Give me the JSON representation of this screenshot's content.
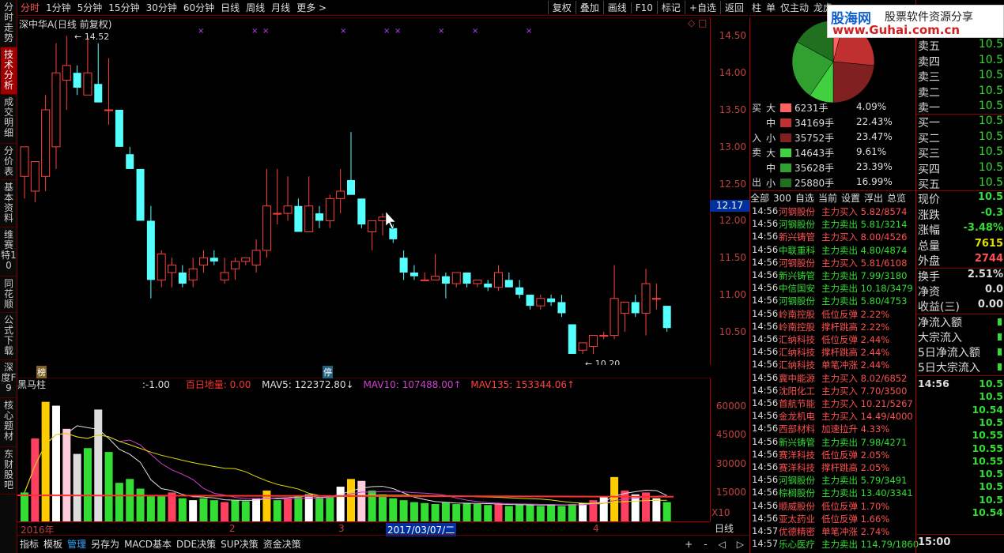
{
  "topbar": {
    "tabs": [
      "分时",
      "1分钟",
      "5分钟",
      "15分钟",
      "30分钟",
      "60分钟",
      "日线",
      "周线",
      "月线",
      "更多 >"
    ],
    "active": 0,
    "right": [
      "复权",
      "叠加",
      "画线",
      "F10",
      "标记",
      "+自选",
      "返回"
    ]
  },
  "leftbar": [
    "分时走势",
    "技术分析",
    "成交明细",
    "分价表",
    "基本资料",
    "维赛特10",
    "同花顺",
    "公式下载",
    "深度F9",
    "核心题材",
    "东财股吧"
  ],
  "chart": {
    "title": "深中华A(日线 前复权)",
    "high_label": "14.52",
    "low_label": "10.20",
    "cur_price": "12.17",
    "price_ticks": [
      "14.50",
      "14.00",
      "13.50",
      "13.00",
      "12.50",
      "12.00",
      "11.50",
      "11.00",
      "10.50"
    ],
    "marker1": "榜",
    "marker2": "停",
    "corner_icons": "◇ □"
  },
  "volume": {
    "title": "黑马柱",
    "v1": ":-1.00",
    "v2": "百日地量: 0.00",
    "mav5": "MAV5: 122372.80↓",
    "mav10": "MAV10: 107488.00↑",
    "mav135": "MAV135: 153344.06↑",
    "ticks": [
      "60000",
      "45000",
      "30000",
      "15000"
    ],
    "x10": "X10"
  },
  "dates": {
    "labels": [
      "2016年",
      "2",
      "3",
      "2017/03/07/二",
      "4"
    ],
    "period": "日线"
  },
  "bottombar": {
    "tabs": [
      "指标",
      "模板",
      "管理",
      "另存为",
      "MACD基本",
      "DDE决策",
      "SUP决策",
      "资金决策"
    ],
    "active": 2,
    "right": [
      "+",
      "-",
      "◁",
      "▷"
    ]
  },
  "midtabs": [
    "柱",
    "单",
    "仅主动",
    "龙虎"
  ],
  "flow": {
    "buy_label": [
      "买",
      "入"
    ],
    "sell_label": [
      "卖",
      "出"
    ],
    "rows": [
      {
        "size": "大",
        "vol": "6231手",
        "pct": "4.09%",
        "color": "#ff6060"
      },
      {
        "size": "中",
        "vol": "34169手",
        "pct": "22.43%",
        "color": "#c03030"
      },
      {
        "size": "小",
        "vol": "35752手",
        "pct": "23.47%",
        "color": "#802020"
      },
      {
        "size": "大",
        "vol": "14643手",
        "pct": "9.61%",
        "color": "#40d040"
      },
      {
        "size": "中",
        "vol": "35628手",
        "pct": "23.39%",
        "color": "#30a030"
      },
      {
        "size": "小",
        "vol": "25880手",
        "pct": "16.99%",
        "color": "#207020"
      }
    ]
  },
  "ticklist_tabs": [
    "全部",
    "300",
    "自选",
    "当前",
    "设置",
    "浮出",
    "总览"
  ],
  "ticks": [
    {
      "t": "14:56",
      "n": "河钢股份",
      "a": "主力买入 5.82/8574",
      "c": "#ff5050"
    },
    {
      "t": "14:56",
      "n": "河钢股份",
      "a": "主力卖出 5.81/3214",
      "c": "#33dd33"
    },
    {
      "t": "14:56",
      "n": "新兴铸管",
      "a": "主力买入 8.00/4526",
      "c": "#ff5050"
    },
    {
      "t": "14:56",
      "n": "中联重科",
      "a": "主力卖出 4.80/4874",
      "c": "#33dd33"
    },
    {
      "t": "14:56",
      "n": "河钢股份",
      "a": "主力买入 5.81/6108",
      "c": "#ff5050"
    },
    {
      "t": "14:56",
      "n": "新兴铸管",
      "a": "主力卖出 7.99/3180",
      "c": "#33dd33"
    },
    {
      "t": "14:56",
      "n": "中信国安",
      "a": "主力卖出 10.18/3479",
      "c": "#33dd33"
    },
    {
      "t": "14:56",
      "n": "河钢股份",
      "a": "主力卖出 5.80/4753",
      "c": "#33dd33"
    },
    {
      "t": "14:56",
      "n": "岭南控股",
      "a": "低位反弹 2.22%",
      "c": "#ff5050"
    },
    {
      "t": "14:56",
      "n": "岭南控股",
      "a": "撑杆跳高 2.22%",
      "c": "#ff5050"
    },
    {
      "t": "14:56",
      "n": "汇纳科技",
      "a": "低位反弹 2.44%",
      "c": "#ff5050"
    },
    {
      "t": "14:56",
      "n": "汇纳科技",
      "a": "撑杆跳高 2.44%",
      "c": "#ff5050"
    },
    {
      "t": "14:56",
      "n": "汇纳科技",
      "a": "单笔冲涨 2.44%",
      "c": "#ff5050"
    },
    {
      "t": "14:56",
      "n": "冀中能源",
      "a": "主力买入 8.02/6852",
      "c": "#ff5050"
    },
    {
      "t": "14:56",
      "n": "沈阳化工",
      "a": "主力买入 7.70/3500",
      "c": "#ff5050"
    },
    {
      "t": "14:56",
      "n": "首航节能",
      "a": "主力买入 10.21/5267",
      "c": "#ff5050"
    },
    {
      "t": "14:56",
      "n": "金龙机电",
      "a": "主力买入 14.49/4000",
      "c": "#ff5050"
    },
    {
      "t": "14:56",
      "n": "西部材料",
      "a": "加速拉升 4.33%",
      "c": "#ff5050"
    },
    {
      "t": "14:56",
      "n": "新兴铸管",
      "a": "主力卖出 7.98/4271",
      "c": "#33dd33"
    },
    {
      "t": "14:56",
      "n": "赛洋科技",
      "a": "低位反弹 2.05%",
      "c": "#ff5050"
    },
    {
      "t": "14:56",
      "n": "赛洋科技",
      "a": "撑杆跳高 2.05%",
      "c": "#ff5050"
    },
    {
      "t": "14:56",
      "n": "河钢股份",
      "a": "主力卖出 5.79/3491",
      "c": "#33dd33"
    },
    {
      "t": "14:56",
      "n": "棕榈股份",
      "a": "主力卖出 13.40/3341",
      "c": "#33dd33"
    },
    {
      "t": "14:56",
      "n": "顺威股份",
      "a": "低位反弹 1.70%",
      "c": "#ff5050"
    },
    {
      "t": "14:56",
      "n": "亚太药业",
      "a": "低位反弹 1.66%",
      "c": "#ff5050"
    },
    {
      "t": "14:57",
      "n": "优德精密",
      "a": "单笔冲涨 2.74%",
      "c": "#ff5050"
    },
    {
      "t": "14:57",
      "n": "乐心医疗",
      "a": "主力卖出 114.79/1860",
      "c": "#33dd33"
    }
  ],
  "orderbook": {
    "sell": [
      {
        "k": "卖五",
        "v": "10.5"
      },
      {
        "k": "卖四",
        "v": "10.5"
      },
      {
        "k": "卖三",
        "v": "10.5"
      },
      {
        "k": "卖二",
        "v": "10.5"
      },
      {
        "k": "卖一",
        "v": "10.5"
      }
    ],
    "buy": [
      {
        "k": "买一",
        "v": "10.5"
      },
      {
        "k": "买二",
        "v": "10.5"
      },
      {
        "k": "买三",
        "v": "10.5"
      },
      {
        "k": "买四",
        "v": "10.5"
      },
      {
        "k": "买五",
        "v": "10.5"
      }
    ]
  },
  "stats": [
    {
      "k": "现价",
      "v": "10.5",
      "c": "#33dd33"
    },
    {
      "k": "涨跌",
      "v": "-0.3",
      "c": "#33dd33"
    },
    {
      "k": "涨幅",
      "v": "-3.48%",
      "c": "#33dd33"
    },
    {
      "k": "总量",
      "v": "7615",
      "c": "#e0e000"
    },
    {
      "k": "外盘",
      "v": "2744",
      "c": "#ff5050"
    }
  ],
  "stats2": [
    {
      "k": "换手",
      "v": "2.51%",
      "c": "#ddd"
    },
    {
      "k": "净资",
      "v": "0.0",
      "c": "#ddd"
    },
    {
      "k": "收益(三)",
      "v": "0.00",
      "c": "#ddd"
    }
  ],
  "flowitems": [
    "净流入额",
    "大宗流入",
    "5日净流入额",
    "5日大宗流入"
  ],
  "trades_time": "14:56",
  "trades": [
    "10.5",
    "10.5",
    "10.54",
    "10.5",
    "10.55",
    "10.55",
    "10.55",
    "10.5",
    "10.5",
    "10.5",
    "10.54"
  ],
  "end_time": "15:00",
  "logo": {
    "a": "股海网",
    "b": "股票软件资源分享",
    "c": "www.Guhai.com.cn"
  }
}
